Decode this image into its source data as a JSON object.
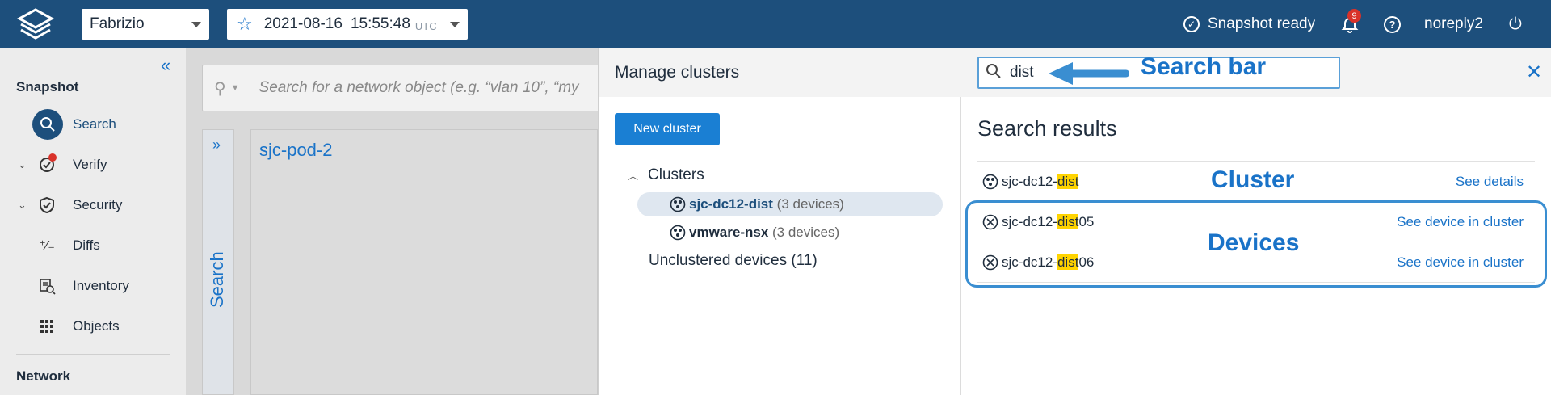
{
  "header": {
    "network": "Fabrizio",
    "snapshot_date": "2021-08-16",
    "snapshot_time": "15:55:48",
    "timezone": "UTC",
    "status": "Snapshot ready",
    "notification_count": "9",
    "username": "noreply2"
  },
  "sidebar": {
    "snapshot_heading": "Snapshot",
    "items": [
      {
        "label": "Search"
      },
      {
        "label": "Verify"
      },
      {
        "label": "Security"
      },
      {
        "label": "Diffs"
      },
      {
        "label": "Inventory"
      },
      {
        "label": "Objects"
      }
    ],
    "network_heading": "Network"
  },
  "main": {
    "search_placeholder": "Search for a network object (e.g. “vlan 10”, “my",
    "vertical_tab": "Search",
    "panel_title": "sjc-pod-2"
  },
  "drawer": {
    "title": "Manage clusters",
    "search_value": "dist",
    "new_cluster_label": "New cluster",
    "clusters_heading": "Clusters",
    "clusters": [
      {
        "name": "sjc-dc12-dist",
        "count": "(3 devices)"
      },
      {
        "name": "vmware-nsx",
        "count": "(3 devices)"
      }
    ],
    "unclustered": "Unclustered devices (11)",
    "results_title": "Search results",
    "results": [
      {
        "prefix": "sjc-dc12-",
        "match": "dist",
        "suffix": "",
        "link": "See details"
      },
      {
        "prefix": "sjc-dc12-",
        "match": "dist",
        "suffix": "05",
        "link": "See device in cluster"
      },
      {
        "prefix": "sjc-dc12-",
        "match": "dist",
        "suffix": "06",
        "link": "See device in cluster"
      }
    ]
  },
  "annotations": {
    "search_bar": "Search bar",
    "cluster": "Cluster",
    "devices": "Devices"
  },
  "colors": {
    "header_bg": "#1d4f7c",
    "accent": "#1a73c8",
    "highlight": "#ffd400",
    "badge": "#d9322a"
  }
}
